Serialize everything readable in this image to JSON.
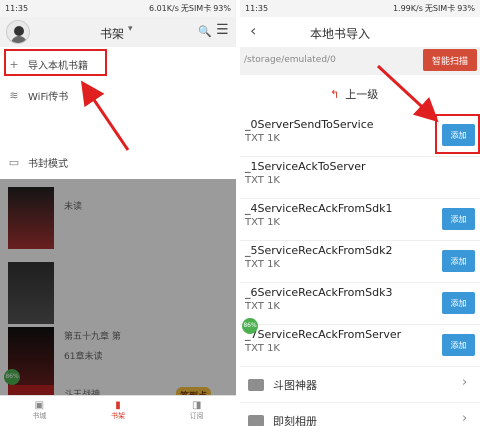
{
  "left": {
    "status": {
      "time": "11:35",
      "speed": "6.01K/s",
      "carrier": "无SIM卡",
      "battery": "93%"
    },
    "appbar": {
      "title": "书架",
      "caret": "▾",
      "search_icon": "🔍",
      "menu_icon": "☰"
    },
    "menu": {
      "items": [
        {
          "icon": "+",
          "label": "导入本机书籍"
        },
        {
          "icon": "≋",
          "label": "WiFi传书"
        },
        {
          "icon": "▭",
          "label": "书封模式"
        }
      ]
    },
    "books": [
      {
        "status": "未读"
      },
      {
        "status": "第五十九章 第",
        "progress": "61章未读"
      },
      {
        "status": "斗王战神"
      }
    ],
    "badge": "86%",
    "promo_bubble": "签到点",
    "tabs": [
      {
        "icon": "▣",
        "label": "书城"
      },
      {
        "icon": "▮",
        "label": "书架"
      },
      {
        "icon": "◨",
        "label": "订阅"
      }
    ]
  },
  "right": {
    "status": {
      "time": "11:35",
      "speed": "1.99K/s",
      "carrier": "无SIM卡",
      "battery": "93%"
    },
    "appbar": {
      "back": "‹",
      "title": "本地书导入"
    },
    "path": "/storage/emulated/0",
    "scan_label": "智能扫描",
    "up_level": {
      "arrow": "↰",
      "label": "上一级"
    },
    "files": [
      {
        "name": "_0ServerSendToService",
        "meta": "TXT  1K",
        "add": "添加"
      },
      {
        "name": "_1ServiceAckToServer",
        "meta": "TXT  1K",
        "add": ""
      },
      {
        "name": "_4ServiceRecAckFromSdk1",
        "meta": "TXT  1K",
        "add": "添加"
      },
      {
        "name": "_5ServiceRecAckFromSdk2",
        "meta": "TXT  1K",
        "add": "添加"
      },
      {
        "name": "_6ServiceRecAckFromSdk3",
        "meta": "TXT  1K",
        "add": "添加"
      },
      {
        "name": "_7ServiceRecAckFromServer",
        "meta": "TXT  1K",
        "add": "添加"
      }
    ],
    "folders": [
      {
        "name": "斗图神器",
        "chevron": "›"
      },
      {
        "name": "即刻相册",
        "chevron": "›"
      }
    ],
    "badge": "86%"
  },
  "colors": {
    "accent_red": "#d8382c",
    "add_blue": "#3a98d9",
    "scan_red": "#d34c38",
    "arrow_red": "#e02020"
  }
}
